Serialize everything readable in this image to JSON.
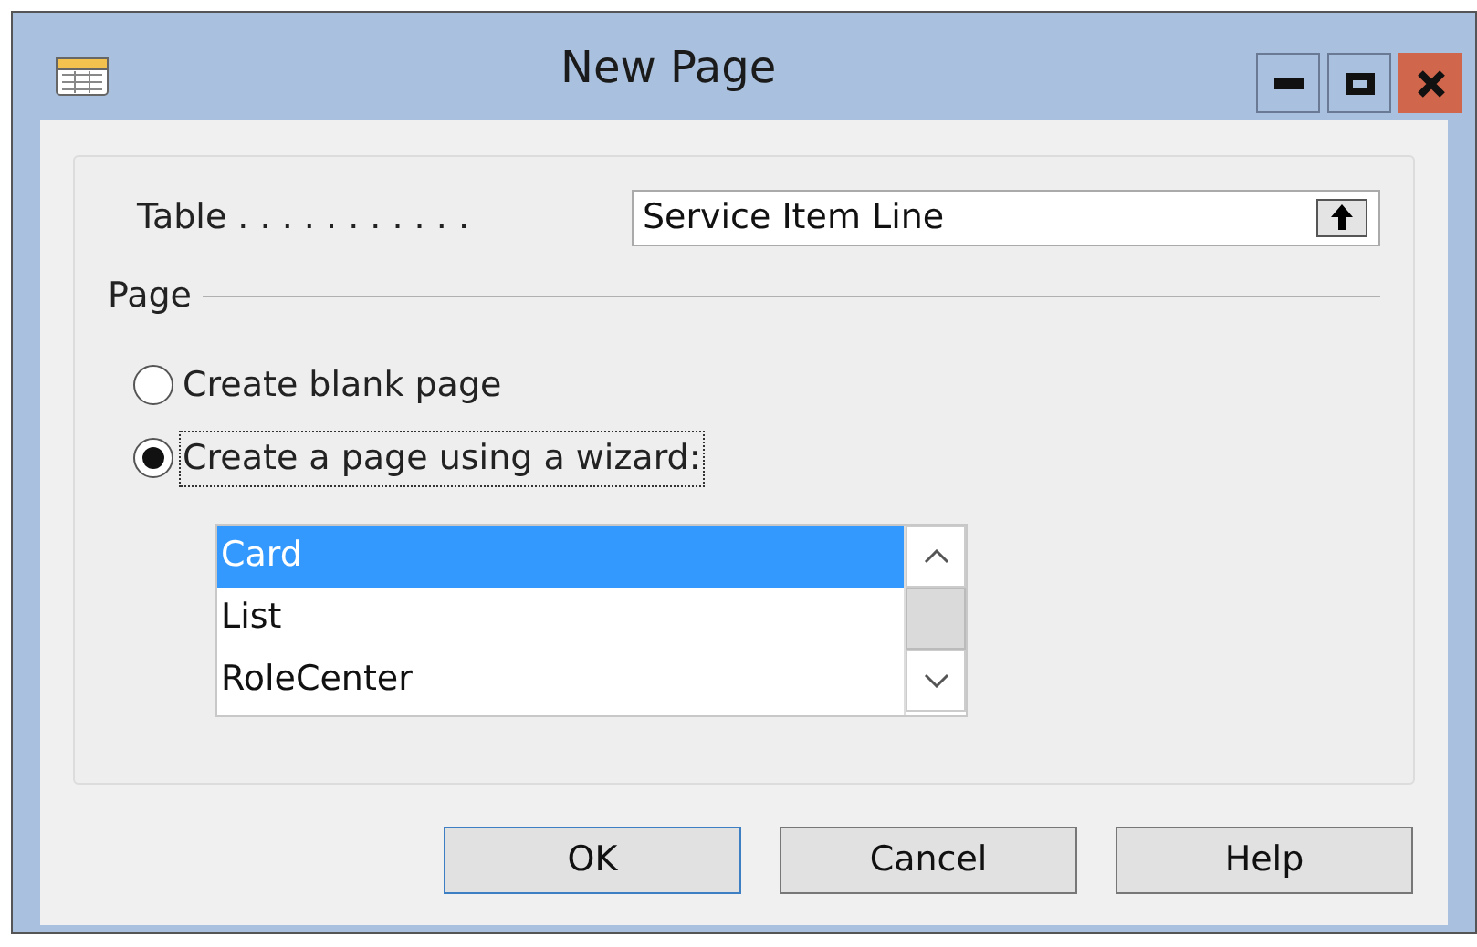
{
  "window": {
    "title": "New Page"
  },
  "table_field": {
    "label": "Table . . . . . . . . . . .",
    "value": "Service Item Line"
  },
  "page_group": {
    "label": "Page"
  },
  "options": [
    {
      "label": "Create blank page",
      "selected": false
    },
    {
      "label": "Create a page using a wizard:",
      "selected": true
    }
  ],
  "wizard_list": [
    {
      "label": "Card",
      "selected": true
    },
    {
      "label": "List",
      "selected": false
    },
    {
      "label": "RoleCenter",
      "selected": false
    }
  ],
  "buttons": [
    {
      "label": "OK",
      "default": true
    },
    {
      "label": "Cancel",
      "default": false
    },
    {
      "label": "Help",
      "default": false
    }
  ]
}
